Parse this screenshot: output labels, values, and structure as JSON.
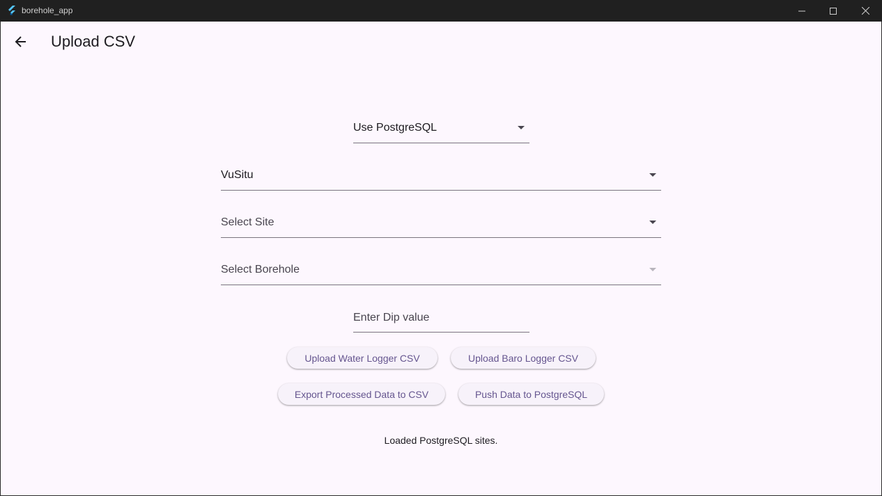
{
  "window": {
    "title": "borehole_app",
    "icon": "flutter-logo-icon"
  },
  "appbar": {
    "back_icon": "arrow-left-icon",
    "title": "Upload CSV"
  },
  "form": {
    "database_select": {
      "value": "Use PostgreSQL"
    },
    "organisation_select": {
      "value": "VuSitu"
    },
    "site_select": {
      "placeholder": "Select Site"
    },
    "borehole_select": {
      "placeholder": "Select Borehole",
      "disabled": true
    },
    "dip_input": {
      "placeholder": "Enter Dip value",
      "value": ""
    }
  },
  "buttons": {
    "upload_water": "Upload Water Logger CSV",
    "upload_baro": "Upload Baro Logger CSV",
    "export_csv": "Export Processed Data to CSV",
    "push_postgres": "Push Data to PostgreSQL"
  },
  "status": {
    "message": "Loaded PostgreSQL sites."
  },
  "colors": {
    "background": "#fdf7fe",
    "titlebar": "#202020",
    "button_text": "#65558f",
    "button_bg": "#f7f2fa",
    "underline": "#79747e"
  }
}
